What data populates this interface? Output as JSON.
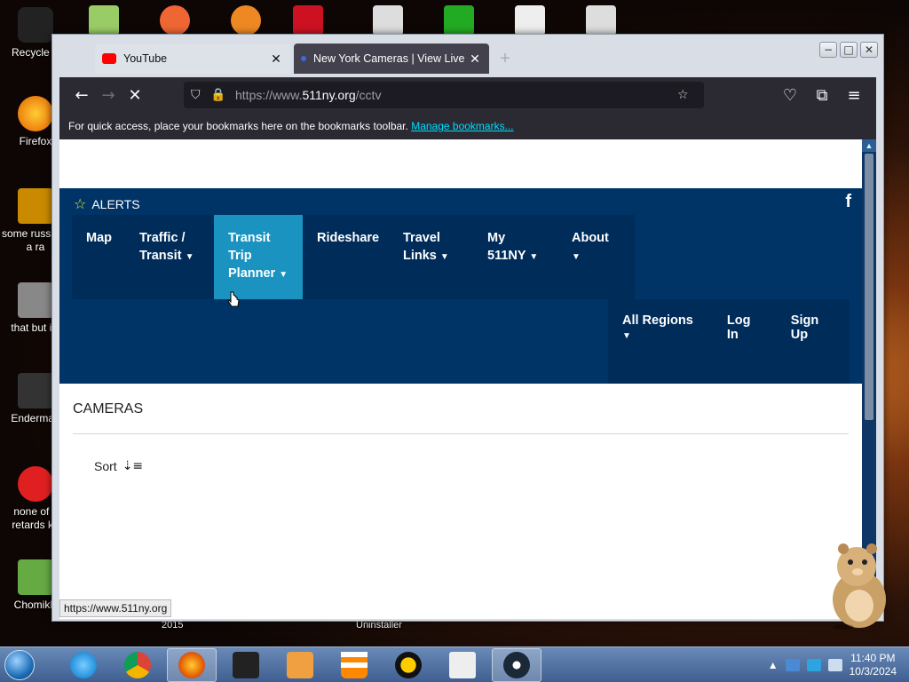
{
  "desktop": {
    "icons": [
      {
        "label": "Recycle B",
        "color": "#222"
      },
      {
        "label": "Firefox",
        "color": "#e66000"
      },
      {
        "label": "some russ ran a ra",
        "color": "#c98a00"
      },
      {
        "label": "that but its",
        "color": "#888"
      },
      {
        "label": "Enderman",
        "color": "#333"
      },
      {
        "label": "none of y retards kn",
        "color": "#e02020"
      },
      {
        "label": "ChomikB",
        "color": "#6a4"
      }
    ],
    "under_labels": [
      "2015",
      "Uninstaller"
    ]
  },
  "browser": {
    "tabs": [
      {
        "title": "YouTube",
        "close": "✕",
        "fav_color": "#ff0000"
      },
      {
        "title": "New York Cameras | View Live N",
        "close": "✕",
        "fav_color": "#3d6bd6"
      }
    ],
    "new_tab": "+",
    "window_buttons": {
      "minimize": "−",
      "maximize": "□",
      "close": "✕"
    },
    "url_prefix": "https://www.",
    "url_domain": "511ny.org",
    "url_path": "/cctv",
    "bookmarks_hint": "For quick access, place your bookmarks here on the bookmarks toolbar.",
    "manage_bookmarks": "Manage bookmarks...",
    "status_url": "https://www.511ny.org"
  },
  "site": {
    "alerts": "ALERTS",
    "facebook": "f",
    "menu": [
      {
        "label": "Map",
        "caret": false
      },
      {
        "label": "Traffic / Transit",
        "caret": true
      },
      {
        "label": "Transit Trip Planner",
        "caret": true,
        "active": true
      },
      {
        "label": "Rideshare",
        "caret": false
      },
      {
        "label": "Travel Links",
        "caret": true
      },
      {
        "label": "My 511NY",
        "caret": true
      },
      {
        "label": "About",
        "caret": true
      }
    ],
    "regions": "All Regions",
    "login": "Log In",
    "signup": "Sign Up",
    "page_title": "CAMERAS",
    "sort_label": "Sort"
  },
  "taskbar": {
    "time": "11:40 PM",
    "date": "10/3/2024"
  }
}
